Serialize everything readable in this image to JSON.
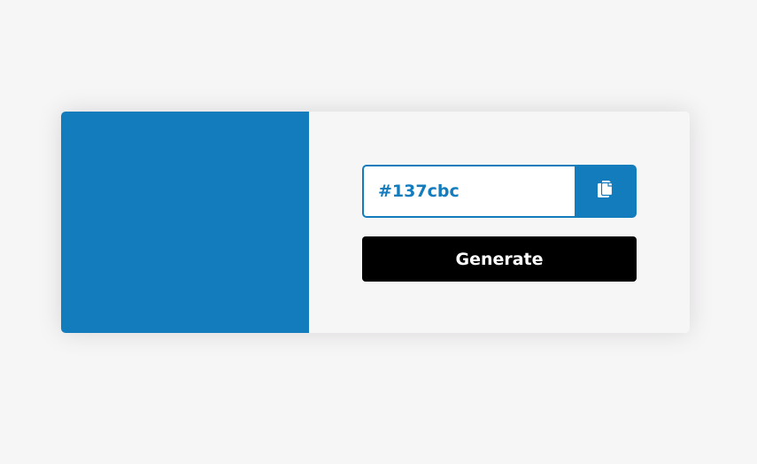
{
  "colors": {
    "background": "#f7f6f7",
    "current_color": "#137cbc",
    "generate_button_bg": "#000000",
    "generate_button_text": "#ffffff"
  },
  "hex_field": {
    "value": "#137cbc"
  },
  "copy_button": {
    "icon": "copy-icon"
  },
  "generate_button": {
    "label": "Generate"
  }
}
